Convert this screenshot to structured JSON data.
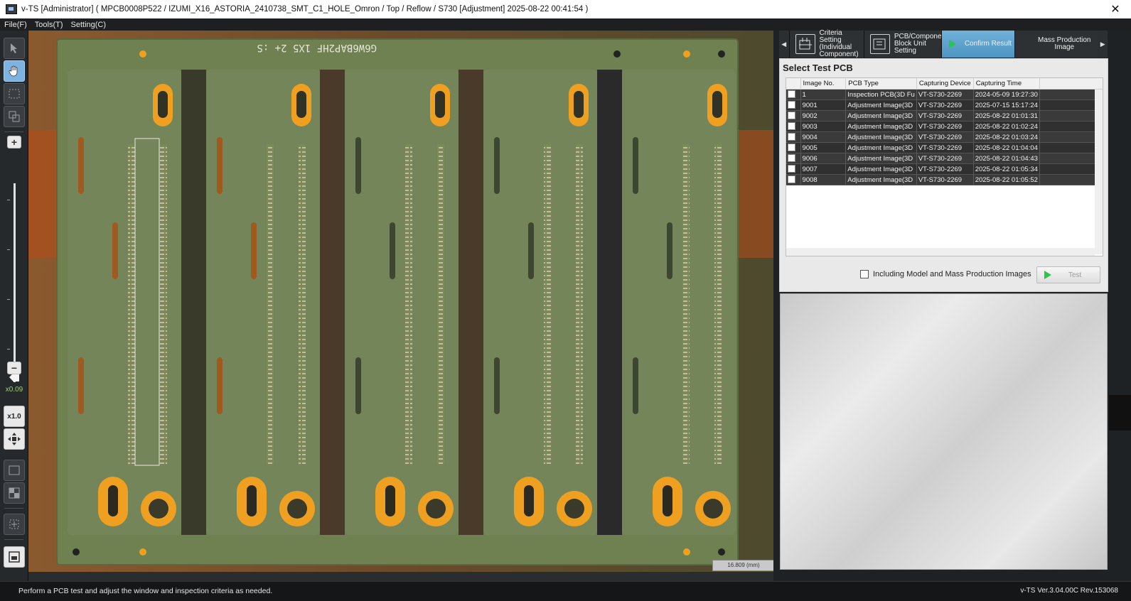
{
  "window": {
    "title": "v-TS [Administrator] ( MPCB0008P522  /  IZUMI_X16_ASTORIA_2410738_SMT_C1_HOLE_Omron  /  Top  /  Reflow  /  S730  [Adjustment]  2025-08-22 00:41:54 )",
    "close_glyph": "✕"
  },
  "menu": [
    "File(F)",
    "Tools(T)",
    "Setting(C)"
  ],
  "toolbar": {
    "zoom_plus": "+",
    "zoom_minus": "−",
    "zoom_value": "x0.09",
    "reset_zoom_label": "x1.0"
  },
  "steps": {
    "prev_glyph": "◀",
    "next_glyph": "▶",
    "tabs": [
      {
        "label": "Criteria Setting\n(Individual\nComponent)",
        "icon": "criteria-setting-icon",
        "active": false
      },
      {
        "label": "PCB/Component\nBlock Unit\nSetting",
        "icon": "pcb-block-setting-icon",
        "active": false
      },
      {
        "label": "Confirm Result",
        "icon": "play-icon",
        "active": true
      },
      {
        "label": "Mass Production\nImage",
        "icon": "",
        "active": false
      }
    ]
  },
  "select_panel": {
    "title": "Select Test PCB",
    "columns": [
      "",
      "Image No.",
      "PCB Type",
      "Capturing Device",
      "Capturing Time"
    ],
    "rows": [
      {
        "image_no": "1",
        "pcb_type": "Inspection PCB(3D Fu",
        "device": "VT-S730-2269",
        "time": "2024-05-09 19:27:30"
      },
      {
        "image_no": "9001",
        "pcb_type": "Adjustment Image(3D",
        "device": "VT-S730-2269",
        "time": "2025-07-15 15:17:24"
      },
      {
        "image_no": "9002",
        "pcb_type": "Adjustment Image(3D",
        "device": "VT-S730-2269",
        "time": "2025-08-22 01:01:31"
      },
      {
        "image_no": "9003",
        "pcb_type": "Adjustment Image(3D",
        "device": "VT-S730-2269",
        "time": "2025-08-22 01:02:24"
      },
      {
        "image_no": "9004",
        "pcb_type": "Adjustment Image(3D",
        "device": "VT-S730-2269",
        "time": "2025-08-22 01:03:24"
      },
      {
        "image_no": "9005",
        "pcb_type": "Adjustment Image(3D",
        "device": "VT-S730-2269",
        "time": "2025-08-22 01:04:04"
      },
      {
        "image_no": "9006",
        "pcb_type": "Adjustment Image(3D",
        "device": "VT-S730-2269",
        "time": "2025-08-22 01:04:43"
      },
      {
        "image_no": "9007",
        "pcb_type": "Adjustment Image(3D",
        "device": "VT-S730-2269",
        "time": "2025-08-22 01:05:34"
      },
      {
        "image_no": "9008",
        "pcb_type": "Adjustment Image(3D",
        "device": "VT-S730-2269",
        "time": "2025-08-22 01:05:52"
      }
    ],
    "include_label": "Including Model and Mass Production Images",
    "test_label": "Test"
  },
  "canvas": {
    "scale_label": "16.809 (mm)",
    "board_text": "G6W6BAP2HF  1X5 2+ :S"
  },
  "status": {
    "message": "Perform a PCB test and adjust the window and inspection criteria as needed.",
    "version": "v-TS Ver.3.04.00C Rev.153068"
  }
}
